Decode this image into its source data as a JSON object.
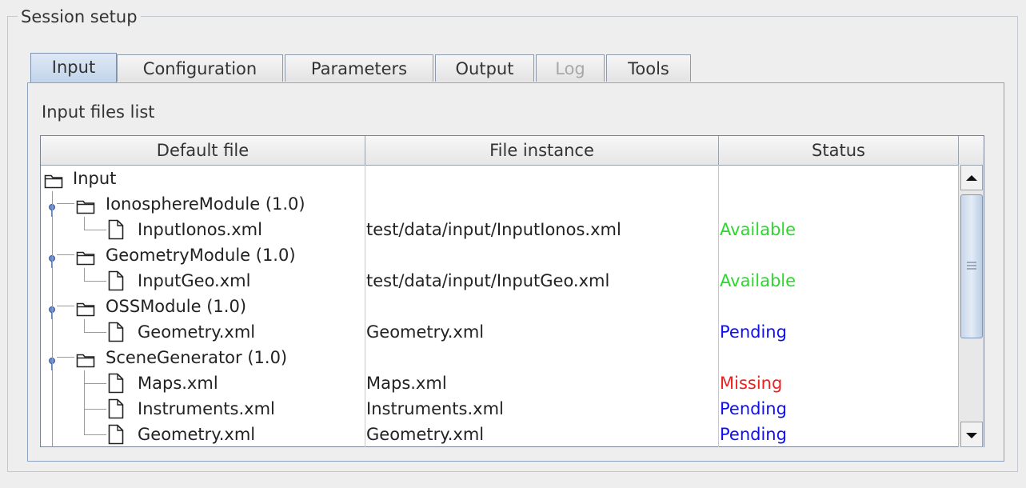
{
  "panel": {
    "title": "Session setup"
  },
  "tabs": [
    {
      "label": "Input",
      "state": "selected"
    },
    {
      "label": "Configuration",
      "state": "normal"
    },
    {
      "label": "Parameters",
      "state": "normal"
    },
    {
      "label": "Output",
      "state": "normal"
    },
    {
      "label": "Log",
      "state": "disabled"
    },
    {
      "label": "Tools",
      "state": "normal"
    }
  ],
  "input_tab": {
    "title": "Input files list",
    "columns": [
      "Default file",
      "File instance",
      "Status"
    ],
    "rows": [
      {
        "type": "root",
        "name": "Input",
        "instance": "",
        "status": ""
      },
      {
        "type": "module",
        "name": "IonosphereModule (1.0)",
        "instance": "",
        "status": ""
      },
      {
        "type": "file",
        "name": "InputIonos.xml",
        "instance": "test/data/input/InputIonos.xml",
        "status": "Available"
      },
      {
        "type": "module",
        "name": "GeometryModule (1.0)",
        "instance": "",
        "status": ""
      },
      {
        "type": "file",
        "name": "InputGeo.xml",
        "instance": "test/data/input/InputGeo.xml",
        "status": "Available"
      },
      {
        "type": "module",
        "name": "OSSModule (1.0)",
        "instance": "",
        "status": ""
      },
      {
        "type": "file",
        "name": "Geometry.xml",
        "instance": "Geometry.xml",
        "status": "Pending"
      },
      {
        "type": "module",
        "name": "SceneGenerator (1.0)",
        "instance": "",
        "status": ""
      },
      {
        "type": "file",
        "name": "Maps.xml",
        "instance": "Maps.xml",
        "status": "Missing"
      },
      {
        "type": "file",
        "name": "Instruments.xml",
        "instance": "Instruments.xml",
        "status": "Pending"
      },
      {
        "type": "file",
        "name": "Geometry.xml",
        "instance": "Geometry.xml",
        "status": "Pending"
      }
    ]
  },
  "status_colors": {
    "Available": "#2bd82b",
    "Pending": "#1010ee",
    "Missing": "#ee2020"
  },
  "icons": {
    "folder": "folder-icon",
    "file": "file-icon",
    "expand": "tree-expanded-handle-icon",
    "scroll_up": "scroll-up-arrow-icon",
    "scroll_down": "scroll-down-arrow-icon",
    "thumb": "scroll-thumb-grip-icon"
  }
}
